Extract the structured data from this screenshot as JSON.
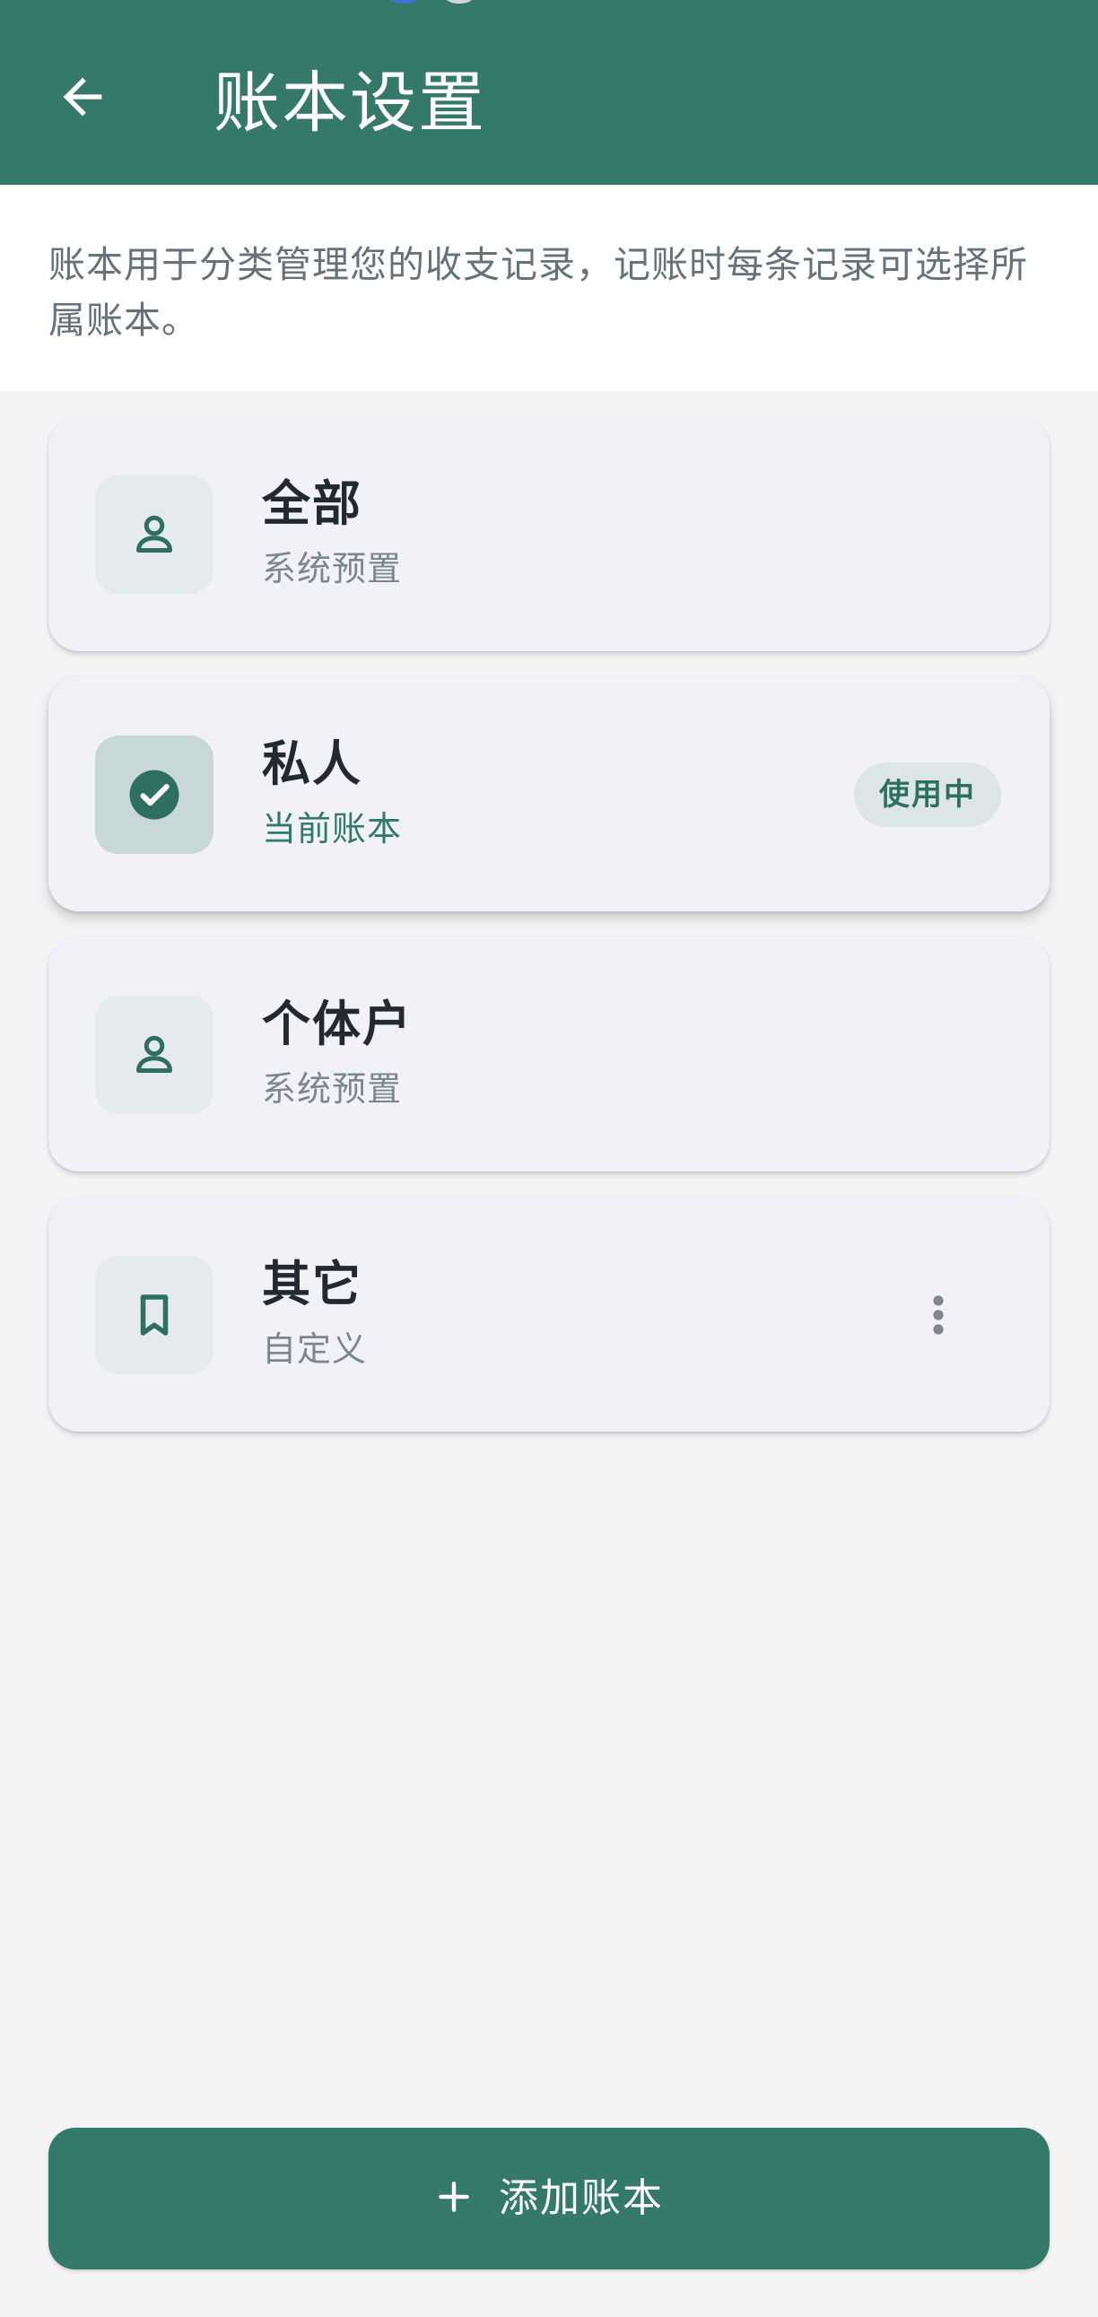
{
  "header": {
    "title": "账本设置",
    "back_icon": "arrow-left-icon",
    "color": "#35796a"
  },
  "description": "账本用于分类管理您的收支记录，记账时每条记录可选择所属账本。",
  "accounts": [
    {
      "name": "全部",
      "subtitle": "系统预置",
      "icon": "person-icon",
      "active": false
    },
    {
      "name": "私人",
      "subtitle": "当前账本",
      "icon": "check-circle-icon",
      "active": true,
      "badge": "使用中"
    },
    {
      "name": "个体户",
      "subtitle": "系统预置",
      "icon": "person-icon",
      "active": false
    },
    {
      "name": "其它",
      "subtitle": "自定义",
      "icon": "bookmark-icon",
      "active": false,
      "has_menu": true,
      "menu_icon": "more-vertical-icon"
    }
  ],
  "footer": {
    "add_label": "添加账本",
    "add_icon": "plus-icon"
  },
  "colors": {
    "primary": "#35796a",
    "icon_bg": "#e4eaed",
    "active_icon_bg": "#c8d8d9",
    "card_bg": "#f3f1f8"
  }
}
